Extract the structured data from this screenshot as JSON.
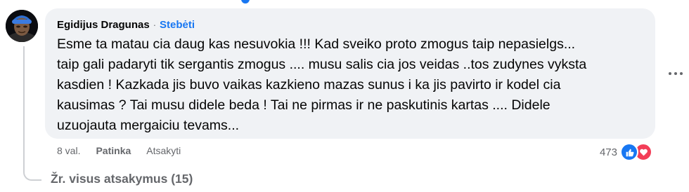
{
  "comment": {
    "author": "Egidijus Dragunas",
    "separator": "·",
    "follow_label": "Stebėti",
    "text": "Esme ta matau cia daug kas nesuvokia !!! Kad sveiko proto zmogus taip nepasielgs...\ntaip gali padaryti tik sergantis zmogus .... musu salis cia jos veidas ..tos zudynes vyksta\nkasdien ! Kazkada jis buvo vaikas kazkieno mazas sunus i ka jis pavirto ir kodel cia\nkausimas ? Tai musu didele beda ! Tai ne pirmas ir ne paskutinis kartas .... Didele\nuzuojauta mergaiciu tevams...",
    "timestamp": "8 val.",
    "like_label": "Patinka",
    "reply_label": "Atsakyti",
    "reaction_count": "473",
    "reactions": [
      "like-icon",
      "love-icon"
    ]
  },
  "view_replies": "Žr. visus atsakymus (15)",
  "colors": {
    "bubble": "#f0f2f5",
    "link_blue": "#1877f2",
    "secondary_text": "#65676b",
    "love_red": "#f33e58"
  }
}
